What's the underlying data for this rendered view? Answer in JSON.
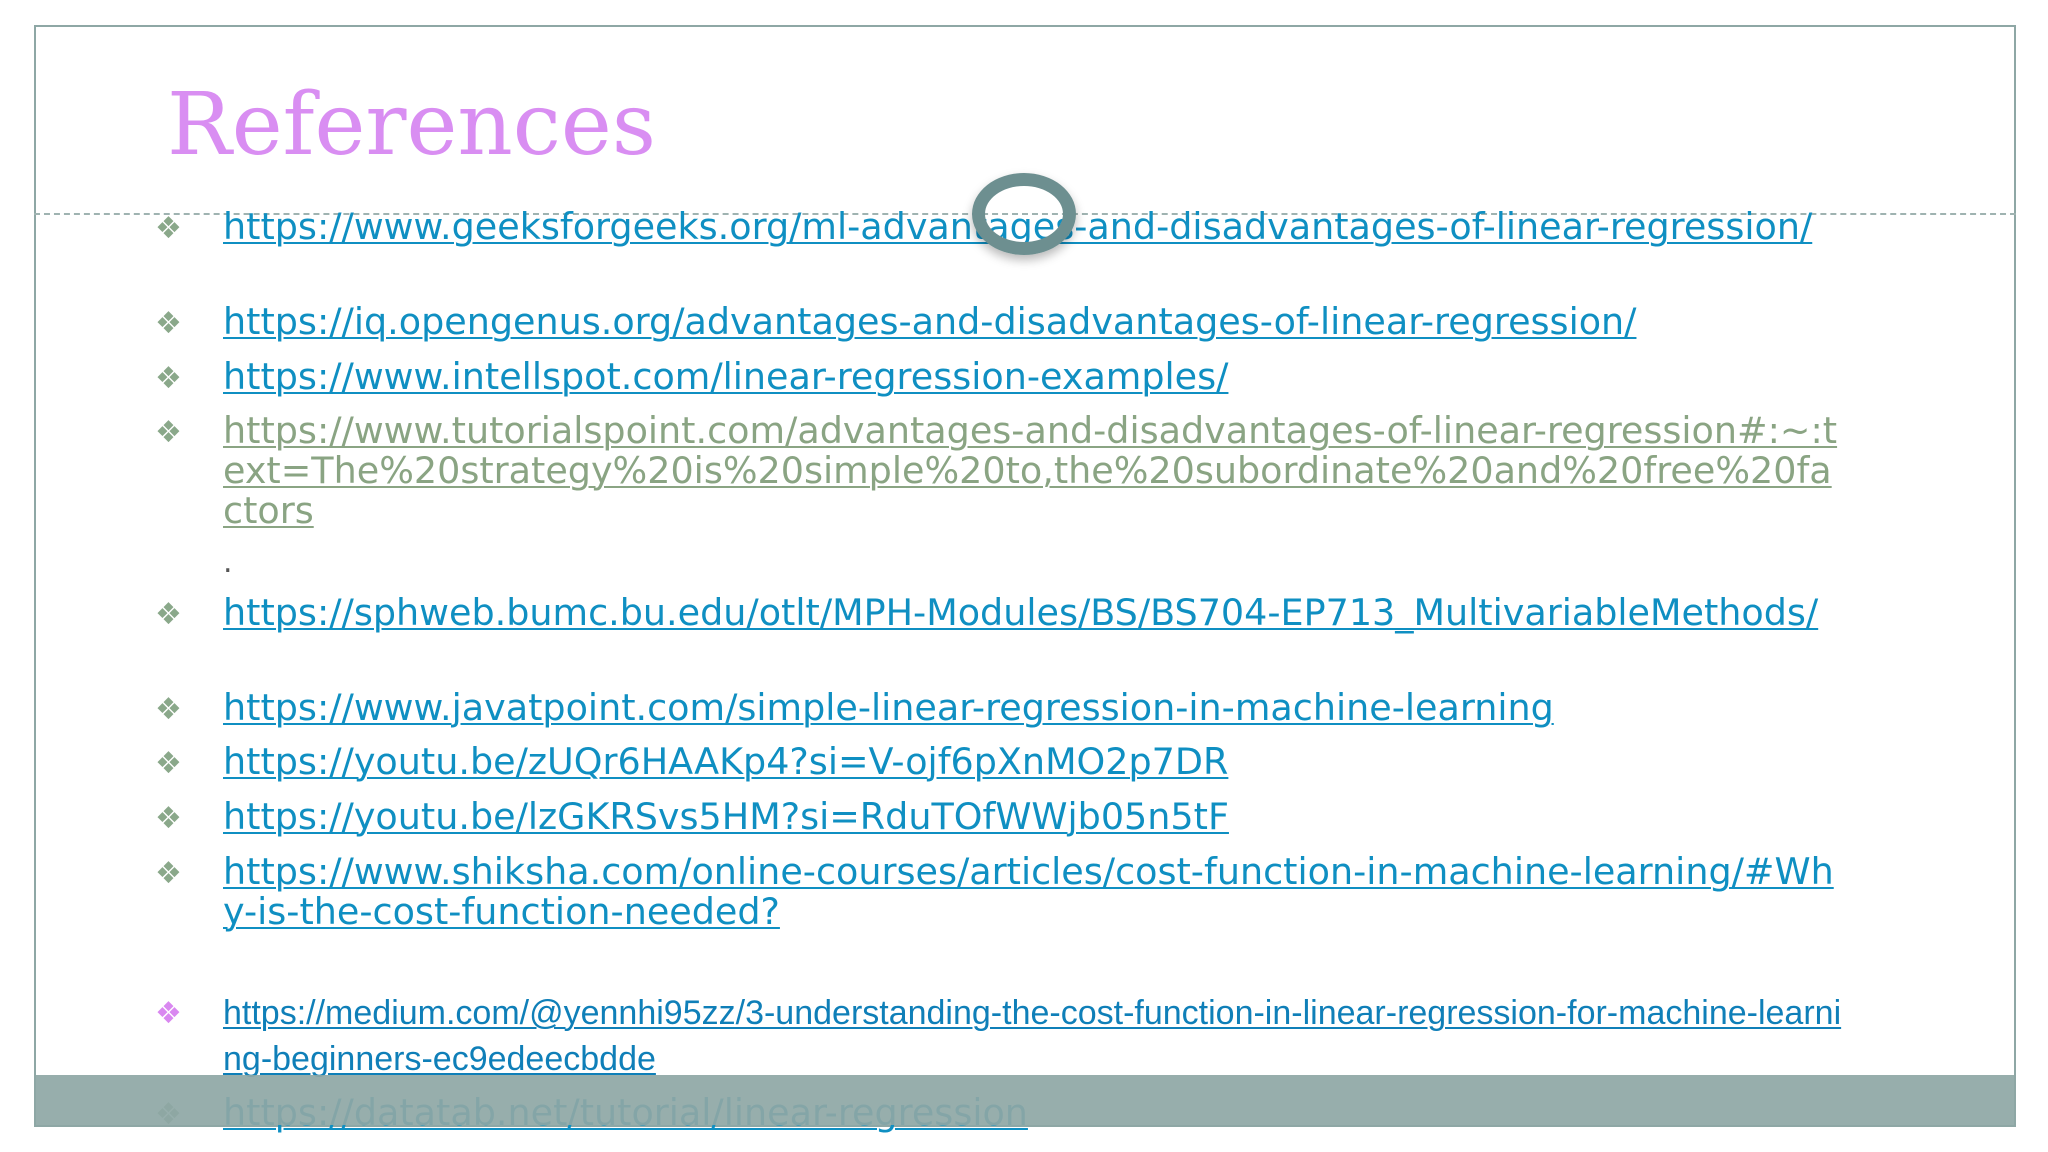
{
  "slide": {
    "title": "References",
    "stray_text": "."
  },
  "colors": {
    "title": "#d98ef2",
    "link": "#0f8fc2",
    "visited_link": "#8aa483",
    "frame": "#8ea7a5",
    "ring": "#6d8f90",
    "bullet": "#8aa88a",
    "bullet_accent": "#d988f0"
  },
  "icons": {
    "bullet": "diamond-bullet-icon",
    "cursor": "loading-ring-icon"
  },
  "references": [
    {
      "bullet": "❖",
      "url": "https://www.geeksforgeeks.org/ml-advantages-and-disadvantages-of-linear-regression/"
    },
    {
      "bullet": "❖",
      "url": "https://iq.opengenus.org/advantages-and-disadvantages-of-linear-regression/"
    },
    {
      "bullet": "❖",
      "url": "https://www.intellspot.com/linear-regression-examples/"
    },
    {
      "bullet": "❖",
      "url": "https://www.tutorialspoint.com/advantages-and-disadvantages-of-linear-regression#:~:text=The%20strategy%20is%20simple%20to,the%20subordinate%20and%20free%20factors"
    },
    {
      "bullet": "❖",
      "url": "https://sphweb.bumc.bu.edu/otlt/MPH-Modules/BS/BS704-EP713_MultivariableMethods/"
    },
    {
      "bullet": "❖",
      "url": "https://www.javatpoint.com/simple-linear-regression-in-machine-learning"
    },
    {
      "bullet": "❖",
      "url": "https://youtu.be/zUQr6HAAKp4?si=V-ojf6pXnMO2p7DR"
    },
    {
      "bullet": "❖",
      "url": "https://youtu.be/lzGKRSvs5HM?si=RduTOfWWjb05n5tF"
    },
    {
      "bullet": "❖",
      "url": "https://www.shiksha.com/online-courses/articles/cost-function-in-machine-learning/#Why-is-the-cost-function-needed?"
    },
    {
      "bullet": "❖",
      "url": "https://medium.com/@yennhi95zz/3-understanding-the-cost-function-in-linear-regression-for-machine-learning-beginners-ec9edeecbdde"
    },
    {
      "bullet": "❖",
      "url": "https://datatab.net/tutorial/linear-regression"
    }
  ]
}
